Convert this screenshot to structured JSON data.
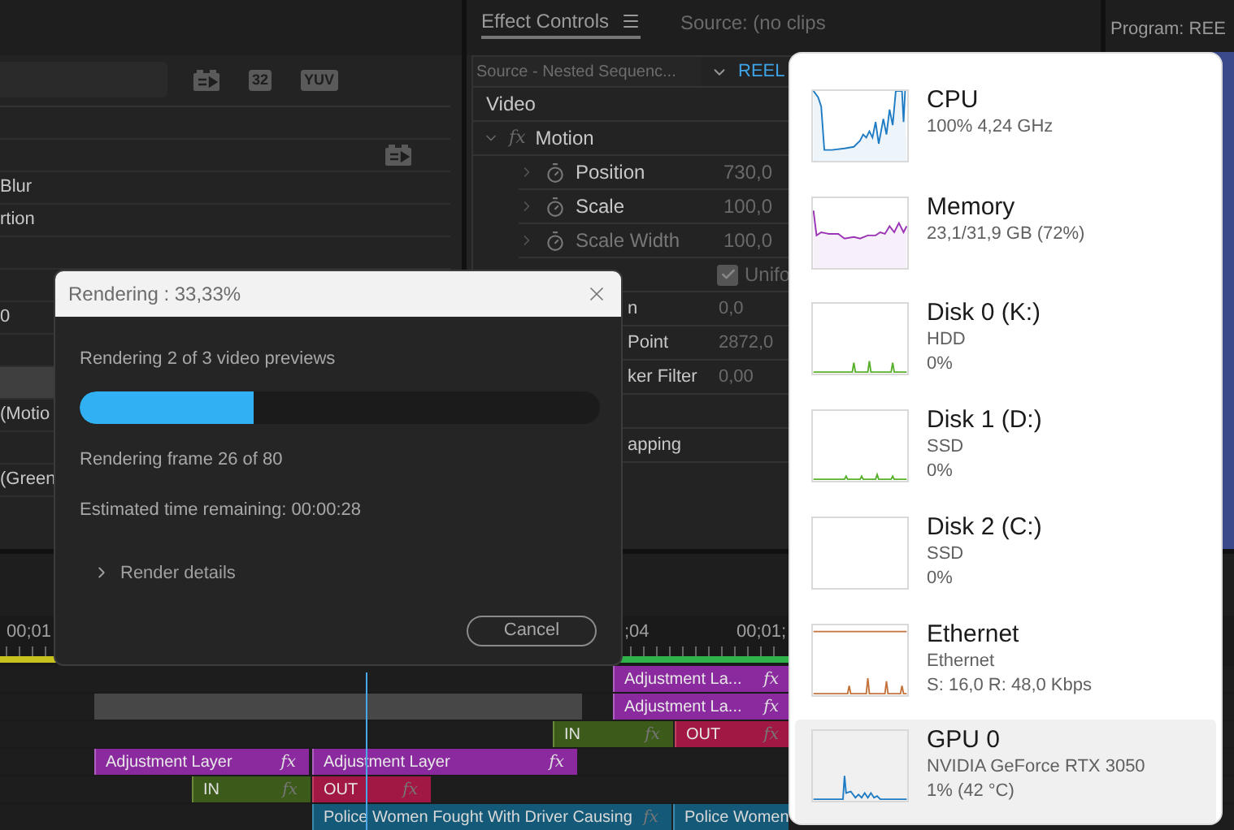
{
  "effects_panel": {
    "format_badges": [
      "32",
      "YUV"
    ],
    "rows": [
      {
        "kind": "item",
        "selected": false
      },
      {
        "kind": "header",
        "selected": false
      },
      {
        "kind": "item",
        "label": "Blur",
        "selected": false
      },
      {
        "kind": "item",
        "label": "rtion",
        "selected": false
      },
      {
        "kind": "item",
        "selected": false
      },
      {
        "kind": "item",
        "selected": false
      },
      {
        "kind": "item",
        "label": "0",
        "selected": false
      },
      {
        "kind": "item",
        "selected": false
      },
      {
        "kind": "item",
        "selected": true
      },
      {
        "kind": "item",
        "label": "(Motio",
        "selected": false
      },
      {
        "kind": "item",
        "selected": false
      },
      {
        "kind": "item",
        "label": "(Green",
        "selected": false
      }
    ]
  },
  "effect_controls": {
    "tabs": [
      {
        "label": "Effect Controls",
        "selected": true
      },
      {
        "label": "Source: (no clips",
        "selected": false
      }
    ],
    "source": "Source - Nested Sequenc...",
    "sequence": "REEL",
    "section": "Video",
    "effect": {
      "badge": "fx",
      "name": "Motion",
      "expanded": true
    },
    "properties": [
      {
        "kind": "property",
        "name": "Position",
        "value": "730,0",
        "disabled": false
      },
      {
        "kind": "property",
        "name": "Scale",
        "value": "100,0",
        "disabled": false
      },
      {
        "kind": "property",
        "name": "Scale Width",
        "value": "100,0",
        "disabled": true
      },
      {
        "kind": "checkbox",
        "label": "Unifo",
        "checked": true
      },
      {
        "kind": "clipped",
        "name": "n",
        "value": "0,0"
      },
      {
        "kind": "clipped",
        "name": "Point",
        "value": "2872,0"
      },
      {
        "kind": "clipped",
        "name": "ker Filter",
        "value": "0,00"
      },
      {
        "kind": "blank"
      },
      {
        "kind": "clipped",
        "name": "apping"
      }
    ]
  },
  "program_monitor": {
    "title": "Program: REE"
  },
  "timeline": {
    "timecodes": [
      "00;01",
      ";04",
      "00;01;"
    ],
    "tracks": [
      [
        {
          "kind": "adjustment",
          "name": "Adjustment La...",
          "badge": "fx"
        }
      ],
      [
        {
          "kind": "gap"
        },
        {
          "kind": "adjustment",
          "name": "Adjustment La...",
          "badge": "fx"
        }
      ],
      [
        {
          "kind": "in",
          "name": "IN",
          "badge": "fx"
        },
        {
          "kind": "out",
          "name": "OUT",
          "badge": "fx"
        }
      ],
      [
        {
          "kind": "adjustment",
          "name": "Adjustment Layer",
          "badge": "fx"
        },
        {
          "kind": "adjustment",
          "name": "Adjustment Layer",
          "badge": "fx"
        }
      ],
      [
        {
          "kind": "in",
          "name": "IN",
          "badge": "fx"
        },
        {
          "kind": "out",
          "name": "OUT",
          "badge": "fx"
        }
      ],
      [
        {
          "kind": "video",
          "name": "Police Women Fought With Driver Causing",
          "badge": "fx"
        },
        {
          "kind": "video",
          "name": "Police Women"
        }
      ]
    ]
  },
  "render_dialog": {
    "title": "Rendering : 33,33%",
    "status": "Rendering 2 of 3 video previews",
    "level": 0.333,
    "frame": "Rendering frame 26 of 80",
    "remaining": "Estimated time remaining: 00:00:28",
    "details": "Render details",
    "details_expanded": false,
    "cancel": "Cancel"
  },
  "performance": {
    "items": [
      {
        "name": "CPU",
        "lines": [
          "100%  4,24 GHz"
        ],
        "color": "#1f7cc4",
        "selected": false
      },
      {
        "name": "Memory",
        "lines": [
          "23,1/31,9 GB (72%)"
        ],
        "color": "#9b33b5",
        "selected": false
      },
      {
        "name": "Disk 0 (K:)",
        "lines": [
          "HDD",
          "0%"
        ],
        "color": "#58b02c",
        "selected": false
      },
      {
        "name": "Disk 1 (D:)",
        "lines": [
          "SSD",
          "0%"
        ],
        "color": "#58b02c",
        "selected": false
      },
      {
        "name": "Disk 2 (C:)",
        "lines": [
          "SSD",
          "0%"
        ],
        "selected": false
      },
      {
        "name": "Ethernet",
        "lines": [
          "Ethernet",
          "S: 16,0  R: 48,0 Kbps"
        ],
        "color": "#c5733c",
        "selected": false
      },
      {
        "name": "GPU 0",
        "lines": [
          "NVIDIA GeForce RTX 3050",
          "1%  (42 °C)"
        ],
        "color": "#1f7cc4",
        "selected": true
      }
    ]
  }
}
